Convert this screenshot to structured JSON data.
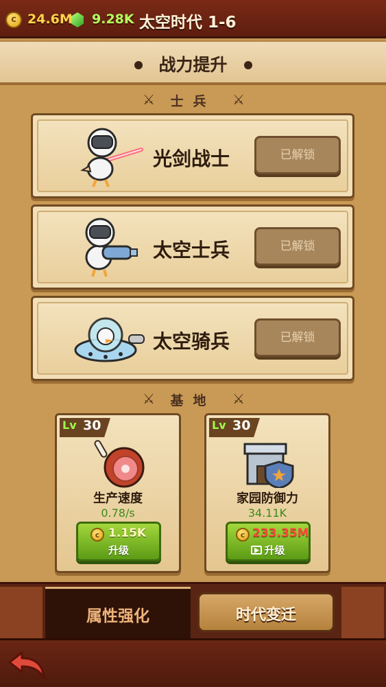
{
  "header": {
    "coins": "24.6M",
    "gems": "9.28K",
    "stage_title": "太空时代 1-6",
    "coin_symbol": "c"
  },
  "banner": {
    "title": "战力提升"
  },
  "soldiers_section": {
    "label": "士兵"
  },
  "units": [
    {
      "name": "光剑战士",
      "button": "已解锁",
      "icon": "space-goose-lightsaber-icon"
    },
    {
      "name": "太空士兵",
      "button": "已解锁",
      "icon": "space-goose-blaster-icon"
    },
    {
      "name": "太空骑兵",
      "button": "已解锁",
      "icon": "goose-ufo-icon"
    }
  ],
  "base_section": {
    "label": "基地"
  },
  "base_upgrades": [
    {
      "lv_tag": "Lv",
      "level": "30",
      "name": "生产速度",
      "value": "0.78/s",
      "cost": "1.15K",
      "cost_color": "#fff4c0",
      "action": "升级",
      "icon": "ham-meat-icon"
    },
    {
      "lv_tag": "Lv",
      "level": "30",
      "name": "家园防御力",
      "value": "34.11K",
      "cost": "233.35M",
      "cost_color": "#ff4a3a",
      "action": "升级",
      "icon": "castle-shield-icon",
      "video": true
    }
  ],
  "tabs": {
    "active": "属性强化",
    "other": "时代变迁"
  },
  "colors": {
    "accent_green": "#5b9b15",
    "frame_brown": "#6f4a22",
    "topbar": "#7a2a16"
  }
}
